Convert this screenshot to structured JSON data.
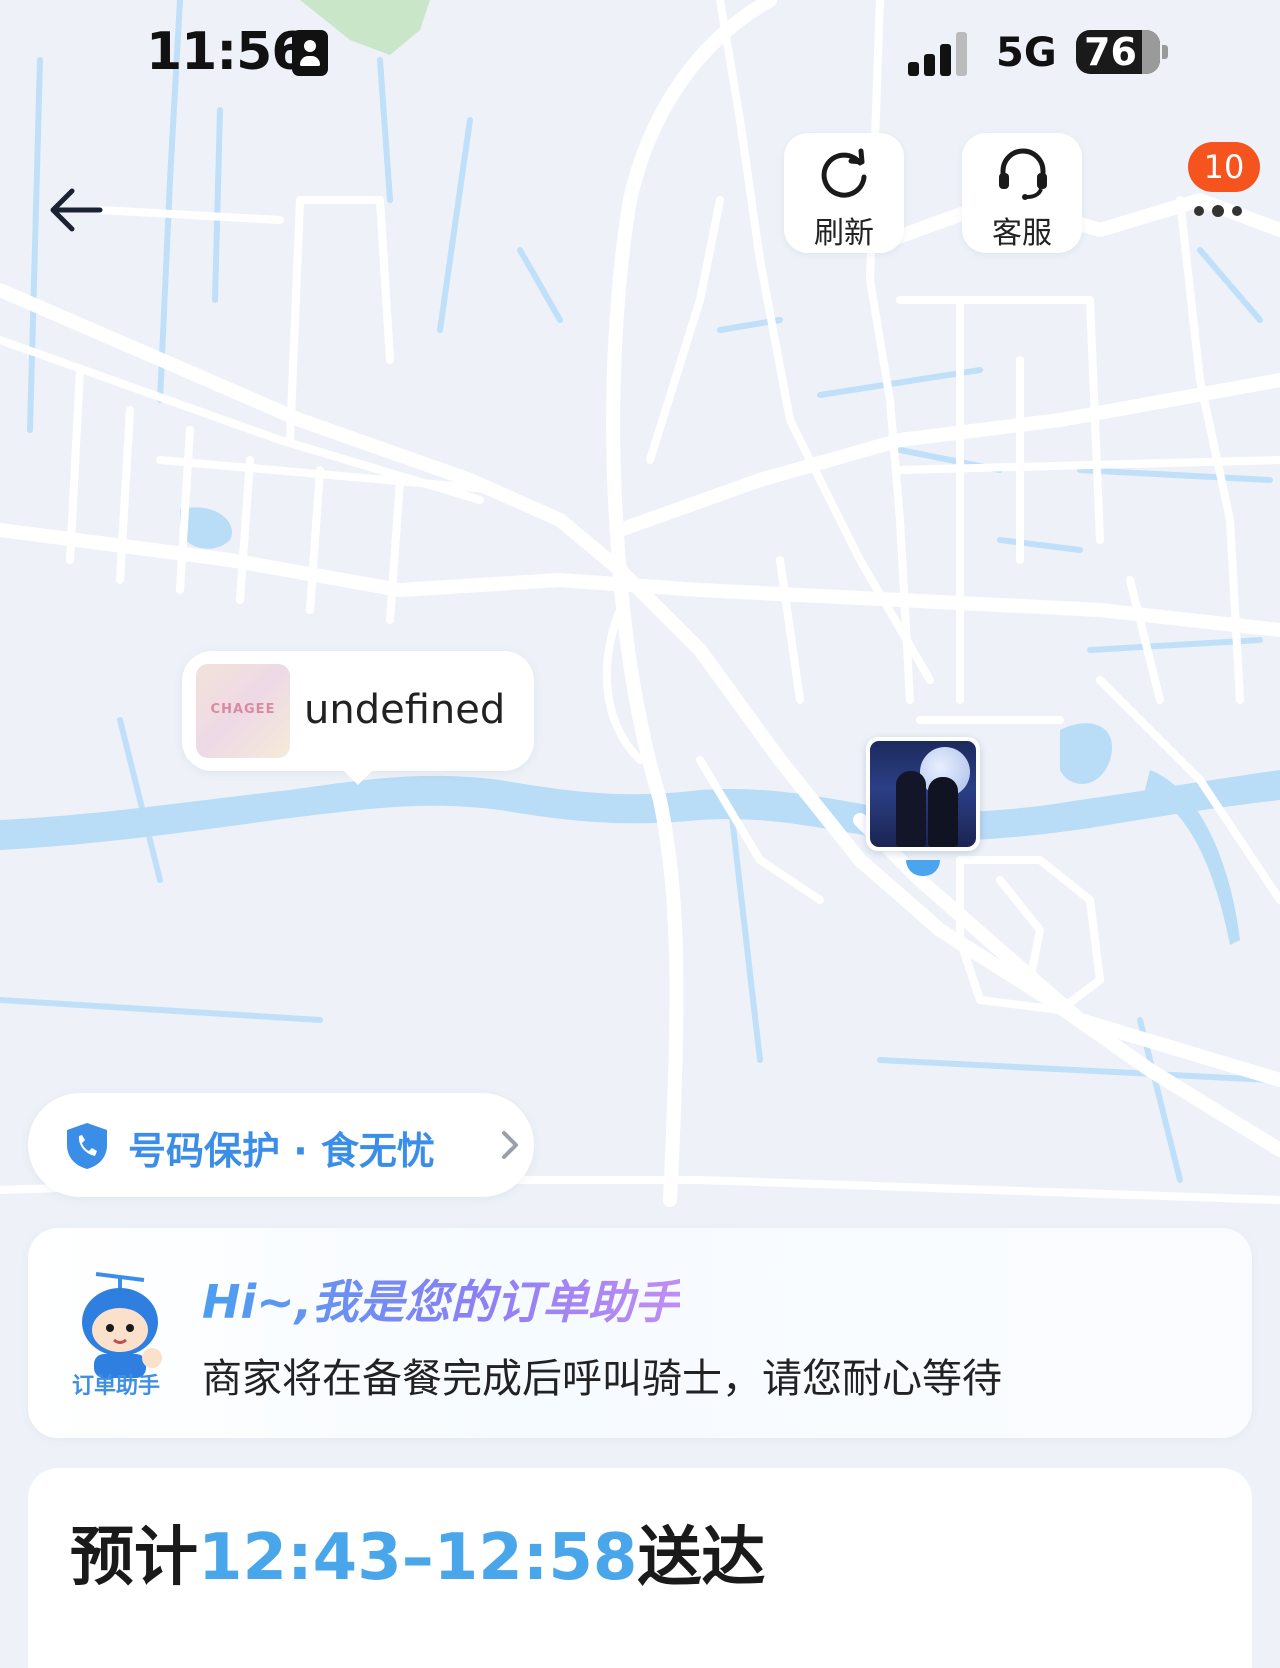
{
  "status_bar": {
    "time": "11:56",
    "network": "5G",
    "battery": "76"
  },
  "header": {
    "back_icon": "arrow-left-icon",
    "refresh_label": "刷新",
    "support_label": "客服",
    "more_badge": "10"
  },
  "map": {
    "store_label": "undefined",
    "store_thumb_text": "CHAGEE"
  },
  "privacy_banner": {
    "label": "号码保护 · 食无忧",
    "icon": "shield-phone-icon"
  },
  "assistant": {
    "title": "Hi~,我是您的订单助手",
    "message": "商家将在备餐完成后呼叫骑士，请您耐心等待",
    "mascot_label": "订单助手"
  },
  "delivery": {
    "prefix": "预计",
    "time_range": "12:43–12:58",
    "suffix": "送达"
  },
  "colors": {
    "accent_blue": "#4aa6ea",
    "badge_orange": "#f5541f",
    "map_bg": "#eef2f8",
    "water": "#b9dcf7"
  }
}
